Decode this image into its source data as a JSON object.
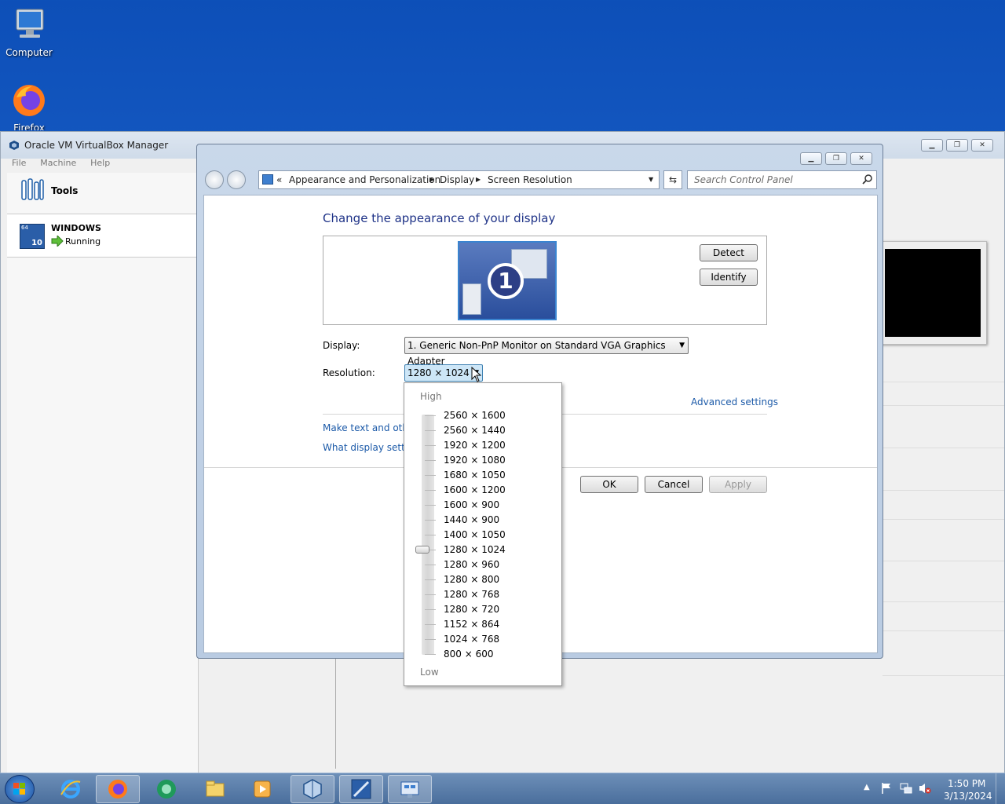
{
  "desktop": {
    "icons": [
      {
        "label": "Computer"
      },
      {
        "label": "Firefox"
      }
    ]
  },
  "vbox": {
    "title": "Oracle VM VirtualBox Manager",
    "menu": [
      "File",
      "Machine",
      "Help"
    ],
    "tools_label": "Tools",
    "vm": {
      "name": "WINDOWS",
      "state": "Running",
      "badge_top": "64",
      "badge_num": "10"
    }
  },
  "control_panel": {
    "breadcrumb_prefix": "«",
    "breadcrumb": [
      "Appearance and Personalization",
      "Display",
      "Screen Resolution"
    ],
    "search_placeholder": "Search Control Panel",
    "heading": "Change the appearance of your display",
    "monitor_number": "1",
    "detect_label": "Detect",
    "identify_label": "Identify",
    "display_label": "Display:",
    "display_value": "1. Generic Non-PnP Monitor on Standard VGA Graphics Adapter",
    "resolution_label": "Resolution:",
    "resolution_value": "1280 × 1024",
    "advanced_link": "Advanced settings",
    "link_text_size": "Make text and other",
    "link_display_settings": "What display setting",
    "ok_label": "OK",
    "cancel_label": "Cancel",
    "apply_label": "Apply"
  },
  "resolution_dropdown": {
    "high_label": "High",
    "low_label": "Low",
    "options": [
      "2560 × 1600",
      "2560 × 1440",
      "1920 × 1200",
      "1920 × 1080",
      "1680 × 1050",
      "1600 × 1200",
      "1600 × 900",
      "1440 × 900",
      "1400 × 1050",
      "1280 × 1024",
      "1280 × 960",
      "1280 × 800",
      "1280 × 768",
      "1280 × 720",
      "1152 × 864",
      "1024 × 768",
      "800 × 600"
    ],
    "selected": "1280 × 1024"
  },
  "taskbar": {
    "clock_time": "1:50 PM",
    "clock_date": "3/13/2024",
    "items": [
      "start-button",
      "internet-explorer-icon",
      "firefox-icon",
      "media-center-icon",
      "file-explorer-icon",
      "media-player-icon",
      "virtualbox-icon",
      "windows10-vm-icon",
      "control-panel-icon"
    ]
  },
  "colors": {
    "heading": "#1e3287",
    "link": "#1c5aa8",
    "desktop": "#1560c9"
  }
}
